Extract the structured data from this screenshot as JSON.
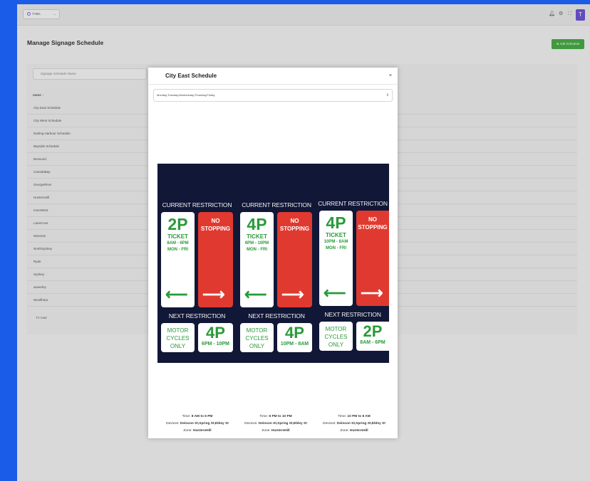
{
  "topbar": {
    "org_name": "TYBA",
    "user_initial": "T",
    "icons": [
      "bell-icon",
      "settings-icon",
      "fullscreen-icon"
    ]
  },
  "page": {
    "title": "Manage Signage Schedule",
    "add_button": "⊕ Add Schedule",
    "search_placeholder": "Signage Schedule Name",
    "column_header": "name ↓",
    "rows": [
      "City East Schedule",
      "City West Schedule",
      "Darling Harbour Schedule",
      "Bayside Schedule",
      "Burwood",
      "CanadaBay",
      "GeorgeRiver",
      "HuntersHill",
      "InnerWest",
      "LaneCove",
      "Mosman",
      "NorthSydney",
      "Ryde",
      "Sydney",
      "waverley",
      "Woollhara"
    ],
    "footer_text": "TV total"
  },
  "modal": {
    "title": "City East Schedule",
    "close": "×",
    "days_value": "Monday,Tuesday,Wednesday,Thursday,Friday",
    "signs": [
      {
        "current_label": "CURRENT RESTRICTION",
        "permit": "2P",
        "ticket": "TICKET",
        "hours": "8AM - 6PM",
        "days": "MON - FRI",
        "no_stopping_1": "NO",
        "no_stopping_2": "STOPPING",
        "next_label": "NEXT RESTRICTION",
        "moto_1": "MOTOR",
        "moto_2": "CYCLES",
        "moto_3": "ONLY",
        "next_permit": "4P",
        "next_hours": "6PM - 10PM",
        "time_label": "Time:",
        "time_value": "8 AM to 6 PM",
        "devices_label": "Devices:",
        "devices_value": "Deinson St,Spring St,Ebley St",
        "zone_label": "Zone:",
        "zone_value": "HuntersHill"
      },
      {
        "current_label": "CURRENT RESTRICTION",
        "permit": "4P",
        "ticket": "TICKET",
        "hours": "6PM - 10PM",
        "days": "MON - FRI",
        "no_stopping_1": "NO",
        "no_stopping_2": "STOPPING",
        "next_label": "NEXT RESTRICTION",
        "moto_1": "MOTOR",
        "moto_2": "CYCLES",
        "moto_3": "ONLY",
        "next_permit": "4P",
        "next_hours": "10PM - 8AM",
        "time_label": "Time:",
        "time_value": "6 PM to 10 PM",
        "devices_label": "Devices:",
        "devices_value": "Deinson St,Spring St,Ebley St",
        "zone_label": "Zone:",
        "zone_value": "HuntersHill"
      },
      {
        "current_label": "CURRENT RESTRICTION",
        "permit": "4P",
        "ticket": "TICKET",
        "hours": "10PM - 8AM",
        "days": "MON - FRI",
        "no_stopping_1": "NO",
        "no_stopping_2": "STOPPING",
        "next_label": "NEXT RESTRICTION",
        "moto_1": "MOTOR",
        "moto_2": "CYCLES",
        "moto_3": "ONLY",
        "next_permit": "2P",
        "next_hours": "8AM - 6PM",
        "time_label": "Time:",
        "time_value": "10 PM to 8 AM",
        "devices_label": "Devices:",
        "devices_value": "Deinson St,Spring St,Ebley St",
        "zone_label": "Zone:",
        "zone_value": "HuntersHill"
      }
    ]
  },
  "colors": {
    "background": "#1a5ce8",
    "sign_bg": "#111736",
    "permit_green": "#2a9a3a",
    "no_stopping_red": "#e03a30",
    "add_button": "#46a744",
    "avatar": "#6a52d0"
  }
}
